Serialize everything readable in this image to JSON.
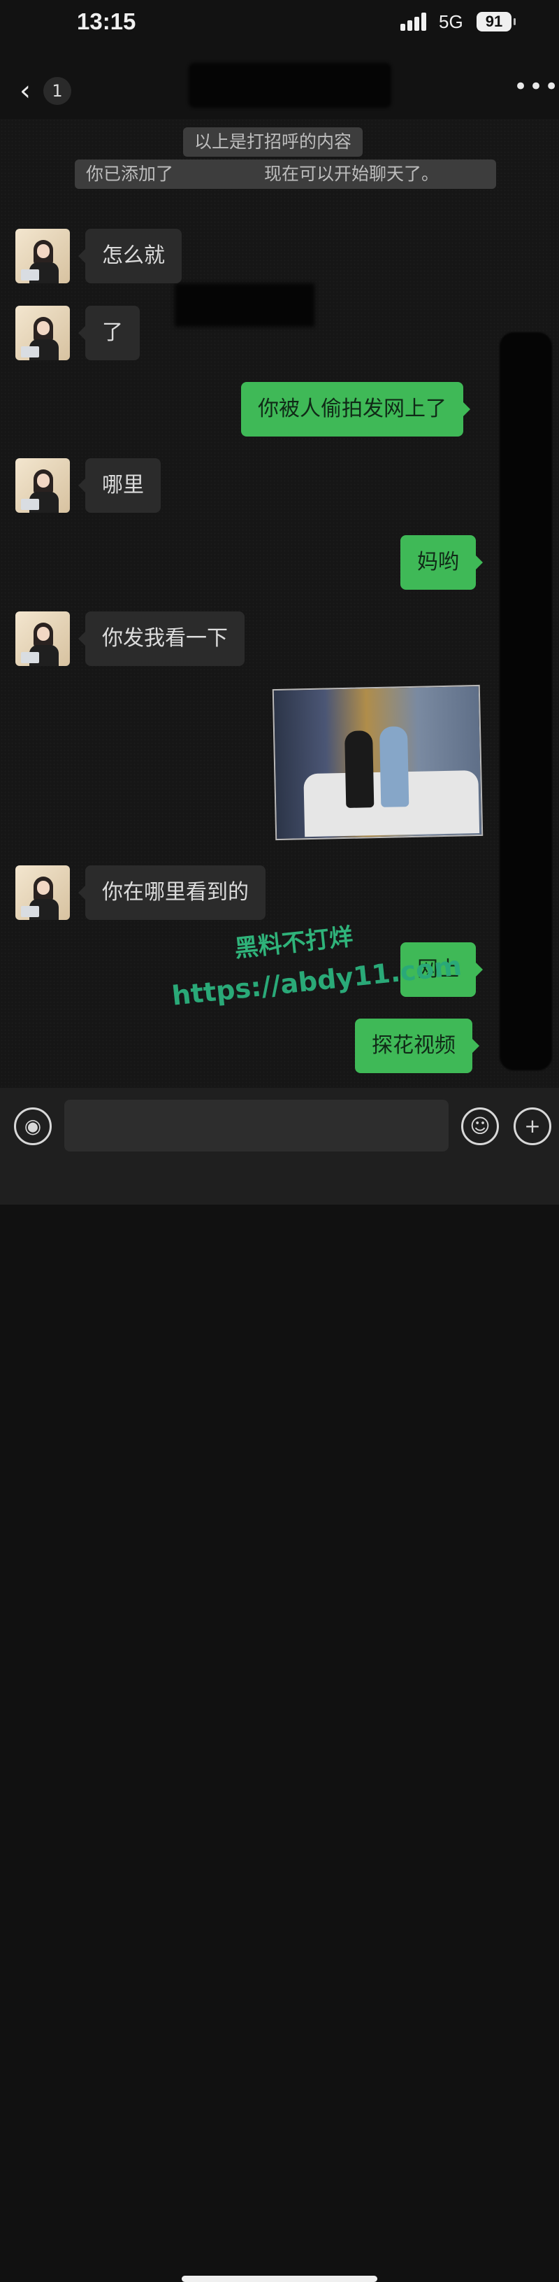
{
  "status": {
    "time": "13:15",
    "network": "5G",
    "battery": "91"
  },
  "header": {
    "back_count": "1"
  },
  "system": [
    "以上是打招呼的内容",
    "你已添加了",
    "现在可以开始聊天了。"
  ],
  "messages": [
    "怎么就",
    "了",
    "你被人偷拍发网上了",
    "哪里",
    "妈哟",
    "你发我看一下",
    "你在哪里看到的",
    "网上",
    "探花视频"
  ],
  "watermark": {
    "line1": "黑料不打烊",
    "line2": "https://abdy11.com"
  },
  "icons": {
    "back": "chevron-left-icon",
    "more": "more-icon",
    "voice": "voice-icon",
    "emoji": "emoji-icon",
    "plus": "plus-icon"
  }
}
